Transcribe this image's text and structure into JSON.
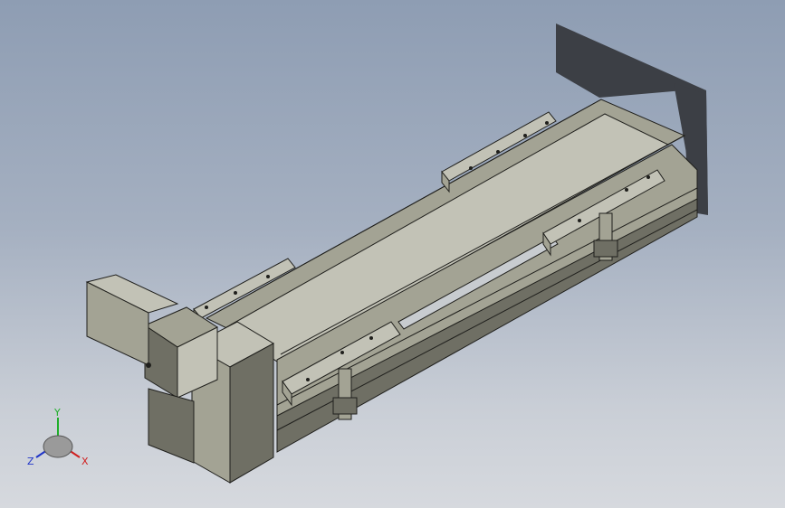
{
  "viewport": {
    "background_top": "#8e9db3",
    "background_bottom": "#d6d9de"
  },
  "model": {
    "part_color": "#a3a394",
    "part_color_dark": "#6f6f64",
    "part_color_light": "#c2c2b6",
    "rail_color": "#c8ccd0",
    "shadow_color": "#3c3f45",
    "edge_color": "#1f1f1c"
  },
  "triad": {
    "x_label": "X",
    "y_label": "Y",
    "z_label": "Z",
    "x_color": "#d02020",
    "y_color": "#1fae2a",
    "z_color": "#2035c8"
  }
}
